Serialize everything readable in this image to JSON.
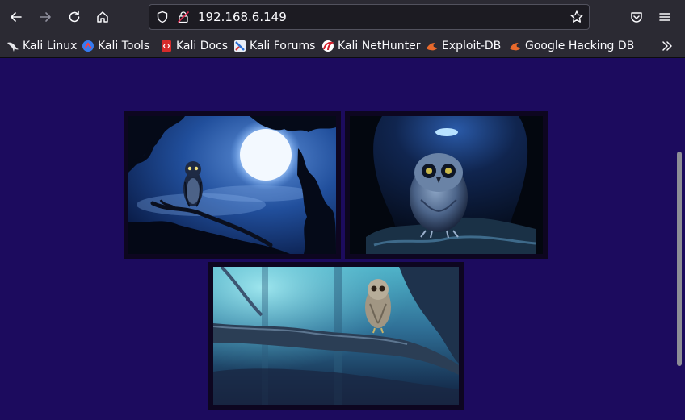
{
  "browser": {
    "url": "192.168.6.149",
    "nav_icons": [
      "back-arrow-icon",
      "forward-arrow-icon",
      "reload-icon",
      "home-icon"
    ],
    "toolbar_icons": [
      "pocket-icon",
      "menu-icon"
    ],
    "bookmarks": [
      {
        "label": "Kali Linux",
        "icon": "kali-dragon-icon"
      },
      {
        "label": "Kali Tools",
        "icon": "kali-tools-icon"
      },
      {
        "label": "Kali Docs",
        "icon": "kali-docs-icon"
      },
      {
        "label": "Kali Forums",
        "icon": "kali-forums-icon"
      },
      {
        "label": "Kali NetHunter",
        "icon": "kali-nethunter-icon"
      },
      {
        "label": "Exploit-DB",
        "icon": "exploit-db-icon"
      },
      {
        "label": "Google Hacking DB",
        "icon": "ghdb-icon"
      }
    ]
  },
  "gallery": {
    "images": [
      {
        "name": "owl-moon-image"
      },
      {
        "name": "owl-cave-image"
      },
      {
        "name": "owl-branch-image"
      }
    ]
  },
  "colors": {
    "page_background": "#1c0b5e",
    "frame": "#0d0620",
    "chrome": "#2b2a33"
  }
}
